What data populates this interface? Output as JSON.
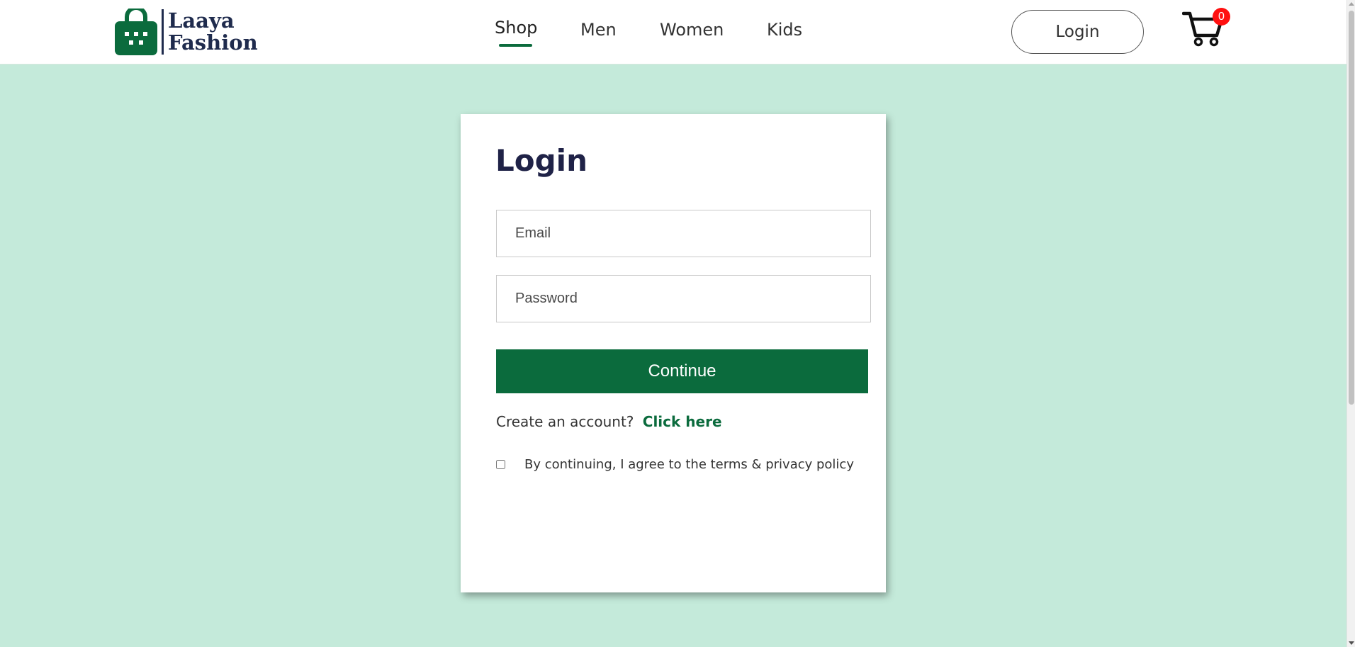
{
  "brand": {
    "name_line1": "Laaya",
    "name_line2": "Fashion",
    "color": "#0b6b3d"
  },
  "nav": {
    "links": [
      {
        "label": "Shop",
        "active": true
      },
      {
        "label": "Men",
        "active": false
      },
      {
        "label": "Women",
        "active": false
      },
      {
        "label": "Kids",
        "active": false
      }
    ],
    "login_label": "Login",
    "cart_icon": "cart-icon",
    "cart_count": "0"
  },
  "login_form": {
    "title": "Login",
    "email_placeholder": "Email",
    "email_value": "",
    "password_placeholder": "Password",
    "password_value": "",
    "continue_label": "Continue",
    "create_account_text": "Create an account?",
    "create_account_link": "Click here",
    "agree_text": "By continuing, I agree to the terms & privacy policy",
    "agree_checked": false
  },
  "colors": {
    "background": "#c4eada",
    "accent": "#0b6b3d",
    "title": "#1f2247",
    "badge": "#ff1010"
  }
}
